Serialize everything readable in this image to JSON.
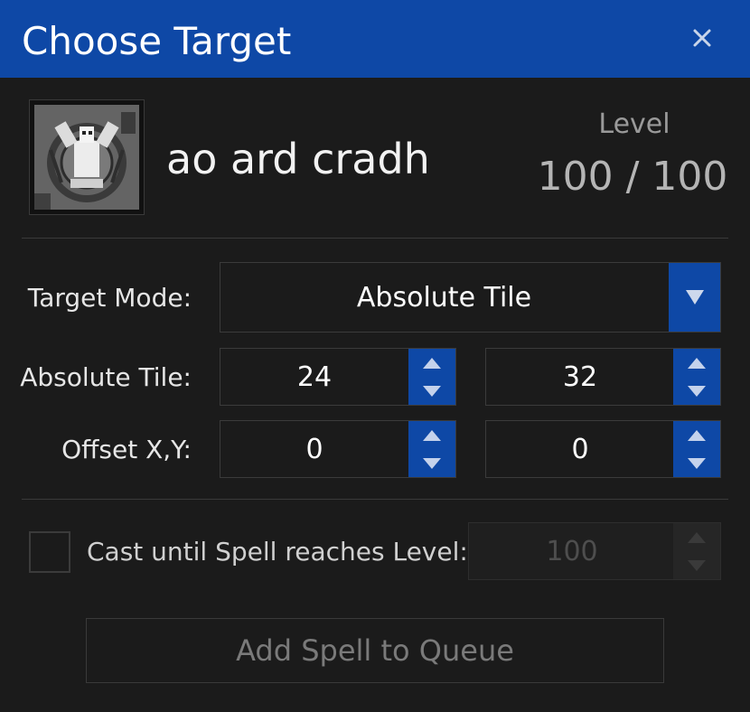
{
  "window": {
    "title": "Choose Target"
  },
  "spell": {
    "icon": "spell-rune-icon",
    "name": "ao ard cradh",
    "level_label": "Level",
    "level_value": "100 / 100"
  },
  "target_mode": {
    "label": "Target Mode:",
    "selected": "Absolute Tile"
  },
  "absolute_tile": {
    "label": "Absolute Tile:",
    "x": "24",
    "y": "32"
  },
  "offset": {
    "label": "Offset X,Y:",
    "x": "0",
    "y": "0"
  },
  "cast_until": {
    "checked": false,
    "label": "Cast until Spell reaches Level:",
    "value": "100"
  },
  "queue_button": {
    "label": "Add Spell to Queue"
  },
  "colors": {
    "accent": "#0e48a6",
    "background": "#1b1b1b",
    "border": "#3b3b3b"
  }
}
